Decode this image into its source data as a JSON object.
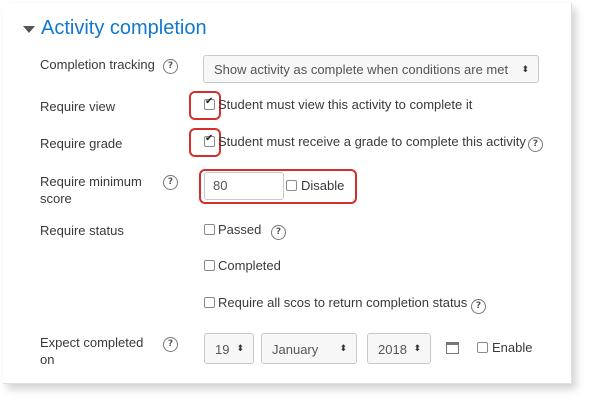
{
  "section": {
    "title": "Activity completion"
  },
  "completion_tracking": {
    "label": "Completion tracking",
    "selected": "Show activity as complete when conditions are met"
  },
  "require_view": {
    "label": "Require view",
    "checkbox_text": "Student must view this activity to complete it",
    "checked": true
  },
  "require_grade": {
    "label": "Require grade",
    "checkbox_text": "Student must receive a grade to complete this activity",
    "checked": true
  },
  "require_min_score": {
    "label_line1": "Require minimum",
    "label_line2": "score",
    "value": "80",
    "disable_label": "Disable",
    "disable_checked": false
  },
  "require_status": {
    "label": "Require status",
    "passed": "Passed",
    "completed": "Completed",
    "require_all": "Require all scos to return completion status"
  },
  "expect_completed": {
    "label_line1": "Expect completed",
    "label_line2": "on",
    "day": "19",
    "month": "January",
    "year": "2018",
    "enable_label": "Enable"
  },
  "icons": {
    "help": "?",
    "select_arrow": "⬍",
    "collapse": "caret-down-icon",
    "calendar": "calendar-icon"
  },
  "colors": {
    "heading": "#1177d1",
    "highlight": "#d32f2f"
  }
}
